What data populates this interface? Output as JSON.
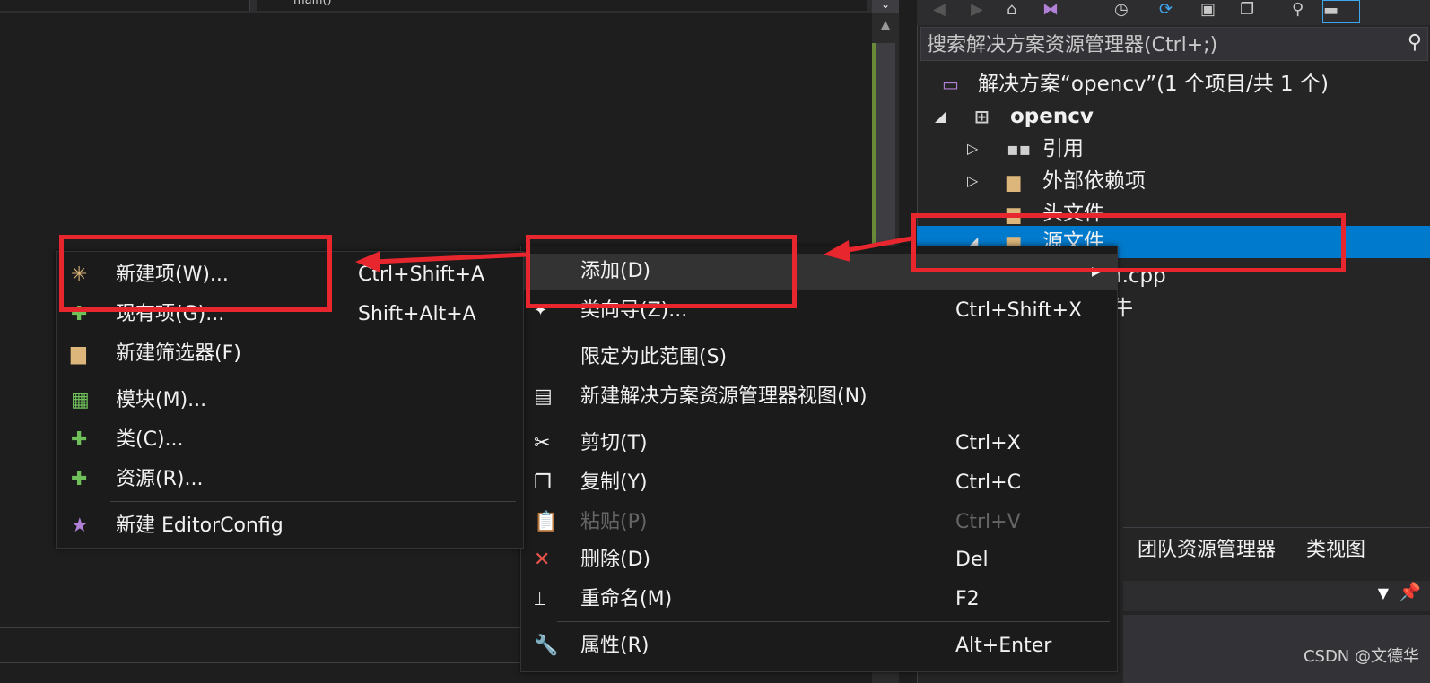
{
  "editor": {
    "nav_function": "main()"
  },
  "scrollbar": {
    "down_glyph": "⌄",
    "up_glyph": "▲"
  },
  "solution_explorer": {
    "search_placeholder": "搜索解决方案资源管理器(Ctrl+;)",
    "tree": [
      {
        "label": "解决方案“opencv”(1 个项目/共 1 个)",
        "icon": "vs-solution-icon"
      },
      {
        "label": "opencv",
        "icon": "cpp-project-icon",
        "expanded": true
      },
      {
        "label": "引用",
        "icon": "references-icon",
        "expanded": false
      },
      {
        "label": "外部依赖项",
        "icon": "external-deps-folder-icon",
        "expanded": false
      },
      {
        "label": "头文件",
        "icon": "filter-folder-icon"
      },
      {
        "label": "源文件",
        "icon": "filter-folder-icon",
        "expanded": true,
        "selected": true
      },
      {
        "label": "n.cpp",
        "icon": "cpp-file-icon"
      },
      {
        "label": "牛",
        "icon": "filter-folder-icon"
      }
    ],
    "tabs": [
      "团队资源管理器",
      "类视图"
    ],
    "selection_color": "#007acc"
  },
  "context_menu": {
    "items": [
      {
        "label": "添加(D)",
        "shortcut": "",
        "icon": "",
        "submenu": true
      },
      {
        "label": "类向导(Z)...",
        "shortcut": "Ctrl+Shift+X",
        "icon": "class-wizard-icon"
      },
      {
        "label": "限定为此范围(S)",
        "shortcut": "",
        "icon": ""
      },
      {
        "label": "新建解决方案资源管理器视图(N)",
        "shortcut": "",
        "icon": "new-view-icon"
      },
      {
        "label": "剪切(T)",
        "shortcut": "Ctrl+X",
        "icon": "scissors-icon"
      },
      {
        "label": "复制(Y)",
        "shortcut": "Ctrl+C",
        "icon": "copy-icon"
      },
      {
        "label": "粘贴(P)",
        "shortcut": "Ctrl+V",
        "icon": "paste-icon",
        "disabled": true
      },
      {
        "label": "删除(D)",
        "shortcut": "Del",
        "icon": "delete-x-icon"
      },
      {
        "label": "重命名(M)",
        "shortcut": "F2",
        "icon": "rename-icon"
      },
      {
        "label": "属性(R)",
        "shortcut": "Alt+Enter",
        "icon": "wrench-icon"
      }
    ]
  },
  "add_submenu": {
    "items": [
      {
        "label": "新建项(W)...",
        "shortcut": "Ctrl+Shift+A",
        "icon": "new-item-icon"
      },
      {
        "label": "现有项(G)...",
        "shortcut": "Shift+Alt+A",
        "icon": "existing-item-icon"
      },
      {
        "label": "新建筛选器(F)",
        "shortcut": "",
        "icon": "new-filter-icon"
      },
      {
        "label": "模块(M)...",
        "shortcut": "",
        "icon": "module-icon"
      },
      {
        "label": "类(C)...",
        "shortcut": "",
        "icon": "class-icon"
      },
      {
        "label": "资源(R)...",
        "shortcut": "",
        "icon": "resource-icon"
      },
      {
        "label": "新建 EditorConfig",
        "shortcut": "",
        "icon": "editorconfig-icon"
      }
    ]
  },
  "annotation_color": "#e8262d",
  "watermark": "CSDN @文德华"
}
